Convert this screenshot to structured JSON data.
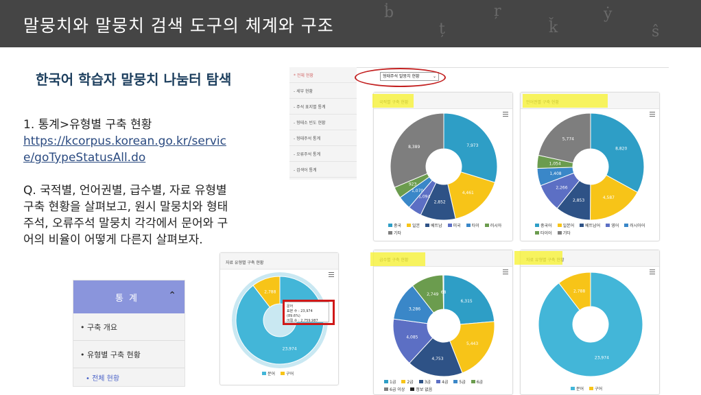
{
  "slide": {
    "title": "말뭉치와 말뭉치 검색 도구의 체계와 구조",
    "subtitle": "한국어 학습자 말뭉치 나눔터 탐색",
    "step_label": "1. 통계>유형별 구축 현황",
    "url": "https://kcorpus.korean.go.kr/service/goTypeStatusAll.do",
    "question": "Q. 국적별, 언어권별, 급수별, 자료 유형별 구축 현황을 살펴보고, 원시 말뭉치와 형태주석, 오류주석 말뭉치 각각에서 문어와 구어의 비율이 어떻게 다른지 살펴보자."
  },
  "nav_panel": {
    "header": "통계",
    "items": [
      "• 구축 개요",
      "• 유형별 구축 현황"
    ],
    "sub_item": "• 전체 현황"
  },
  "site": {
    "side_menu": [
      "* 전체 현황",
      "- 세부 현황",
      "- 주석 표지별 통계",
      "- 형태소 빈도 현황",
      "- 형태주석 통계",
      "- 오류주석 통계",
      "- 검색어 통계"
    ],
    "dropdown_value": "형태주석 말뭉치 현황",
    "tooltip": {
      "line1": "문어",
      "line2": "표본 수 : 23,974 (89.6%)",
      "line3": "어절 수 : 2,759,987"
    }
  },
  "colors": {
    "blue": "#2e9ec6",
    "yellow": "#f7c418",
    "navy": "#2e5286",
    "purple": "#5c6fc4",
    "mid_blue": "#3a87c8",
    "green": "#6b9c4e",
    "gray": "#7e7e7e",
    "sky": "#43b6d8"
  },
  "chart_data": [
    {
      "type": "pie",
      "title": "국적별 구축 현황",
      "categories": [
        "중국",
        "일본",
        "베트남",
        "미국",
        "타이",
        "러시아",
        "기타"
      ],
      "values": [
        7973,
        4461,
        2852,
        1094,
        1070,
        923,
        8389
      ]
    },
    {
      "type": "pie",
      "title": "언어권별 구축 현황",
      "categories": [
        "중국어",
        "일본어",
        "베트남어",
        "영어",
        "러시아어",
        "타이어",
        "기타"
      ],
      "values": [
        8820,
        4587,
        2853,
        2266,
        1408,
        1054,
        5774
      ]
    },
    {
      "type": "pie",
      "title": "급수별 구축 현황",
      "categories": [
        "1급",
        "2급",
        "3급",
        "4급",
        "5급",
        "6급",
        "6급 이상",
        "정보 없음"
      ],
      "values": [
        6315,
        5443,
        4753,
        4085,
        3286,
        2749,
        68,
        0
      ]
    },
    {
      "type": "pie",
      "title": "자료 유형별 구축 현황",
      "categories": [
        "문어",
        "구어"
      ],
      "values": [
        23974,
        2788
      ]
    },
    {
      "type": "pie",
      "title": "자료 유형별 구축 현황",
      "categories": [
        "문어",
        "구어"
      ],
      "values": [
        23974,
        2788
      ]
    }
  ]
}
